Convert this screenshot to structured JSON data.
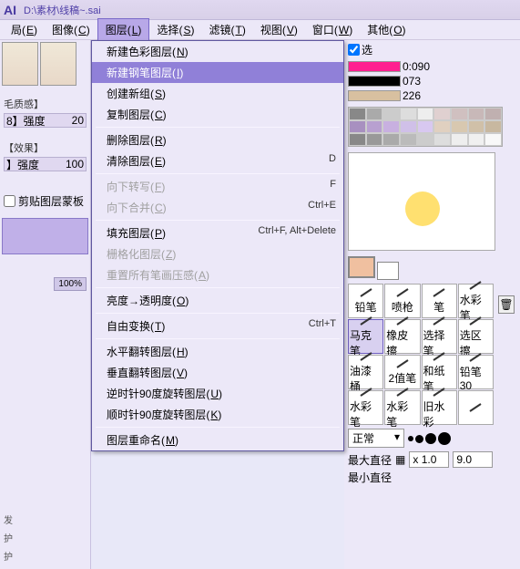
{
  "titlebar": {
    "logo": "AI",
    "path": "D:\\素材\\线稿~.sai"
  },
  "menubar": {
    "items": [
      {
        "label": "局",
        "accel": "E"
      },
      {
        "label": "图像",
        "accel": "C"
      },
      {
        "label": "图层",
        "accel": "L"
      },
      {
        "label": "选择",
        "accel": "S"
      },
      {
        "label": "滤镜",
        "accel": "T"
      },
      {
        "label": "视图",
        "accel": "V"
      },
      {
        "label": "窗口",
        "accel": "W"
      },
      {
        "label": "其他",
        "accel": "O"
      }
    ]
  },
  "dropdown": {
    "items": [
      {
        "label": "新建色彩图层",
        "accel": "N",
        "shortcut": ""
      },
      {
        "label": "新建钢笔图层",
        "accel": "I",
        "shortcut": "",
        "highlighted": true
      },
      {
        "label": "创建新组",
        "accel": "S",
        "shortcut": ""
      },
      {
        "label": "复制图层",
        "accel": "C",
        "shortcut": ""
      },
      {
        "sep": true
      },
      {
        "label": "删除图层",
        "accel": "R",
        "shortcut": ""
      },
      {
        "label": "清除图层",
        "accel": "E",
        "shortcut": "D"
      },
      {
        "sep": true
      },
      {
        "label": "向下转写",
        "accel": "F",
        "shortcut": "F",
        "disabled": true
      },
      {
        "label": "向下合并",
        "accel": "C",
        "shortcut": "Ctrl+E",
        "disabled": true
      },
      {
        "sep": true
      },
      {
        "label": "填充图层",
        "accel": "P",
        "shortcut": "Ctrl+F, Alt+Delete"
      },
      {
        "label": "栅格化图层",
        "accel": "Z",
        "shortcut": "",
        "disabled": true
      },
      {
        "label": "重置所有笔画压感",
        "accel": "A",
        "shortcut": "",
        "disabled": true
      },
      {
        "sep": true
      },
      {
        "label": "亮度→透明度",
        "accel": "O",
        "shortcut": ""
      },
      {
        "sep": true
      },
      {
        "label": "自由变换",
        "accel": "T",
        "shortcut": "Ctrl+T"
      },
      {
        "sep": true
      },
      {
        "label": "水平翻转图层",
        "accel": "H",
        "shortcut": ""
      },
      {
        "label": "垂直翻转图层",
        "accel": "V",
        "shortcut": ""
      },
      {
        "label": "逆时针90度旋转图层",
        "accel": "U",
        "shortcut": ""
      },
      {
        "label": "顺时针90度旋转图层",
        "accel": "K",
        "shortcut": ""
      },
      {
        "sep": true
      },
      {
        "label": "图层重命名",
        "accel": "M",
        "shortcut": ""
      }
    ]
  },
  "left": {
    "section1": "毛质感】",
    "s1_a": "8】强度",
    "s1_av": "20",
    "section2": "【效果】",
    "s2_a": "】强度",
    "s2_av": "100",
    "pct": "100%",
    "clip_chk": "剪贴图层蒙板",
    "modes": [
      "发",
      "护",
      "护"
    ]
  },
  "right": {
    "sel_chk": "选",
    "r1": "0:090",
    "r2": "073",
    "r3": "226",
    "palette_colors": [
      "#888",
      "#aaa",
      "#ccc",
      "#ddd",
      "#eee",
      "#e0d0d0",
      "#d0c0c0",
      "#c8b8b8",
      "#c0b0b0",
      "#a890c0",
      "#b8a0d0",
      "#c8b0e0",
      "#d0c0e8",
      "#d8c8f0",
      "#e0d0c0",
      "#d8c8b0",
      "#d0c0a8",
      "#c8b8a0",
      "#888",
      "#999",
      "#aaa",
      "#bbb",
      "#ccc",
      "#ddd",
      "#eee",
      "#f0f0f0",
      "#f8f8f8"
    ],
    "tools": [
      {
        "name": "铅笔",
        "label": "铅笔"
      },
      {
        "name": "喷枪",
        "label": "喷枪"
      },
      {
        "name": "笔",
        "label": "笔"
      },
      {
        "name": "水彩笔",
        "label": "水彩笔"
      },
      {
        "name": "马克笔",
        "label": "马克笔",
        "sel": true
      },
      {
        "name": "橡皮擦",
        "label": "橡皮擦"
      },
      {
        "name": "选择笔",
        "label": "选择笔"
      },
      {
        "name": "选区擦",
        "label": "选区擦"
      },
      {
        "name": "油漆桶",
        "label": "油漆桶"
      },
      {
        "name": "2值笔",
        "label": "2值笔"
      },
      {
        "name": "和纸笔",
        "label": "和纸笔"
      },
      {
        "name": "铅笔30",
        "label": "铅笔30"
      },
      {
        "name": "水彩笔",
        "label": "水彩笔"
      },
      {
        "name": "水彩笔",
        "label": "水彩笔"
      },
      {
        "name": "旧水彩",
        "label": "旧水彩"
      },
      {
        "name": "",
        "label": ""
      }
    ],
    "blend": "正常",
    "size_label": "最大直径",
    "size_mult": "x 1.0",
    "size_val": "9.0",
    "size2_label": "最小直径"
  }
}
